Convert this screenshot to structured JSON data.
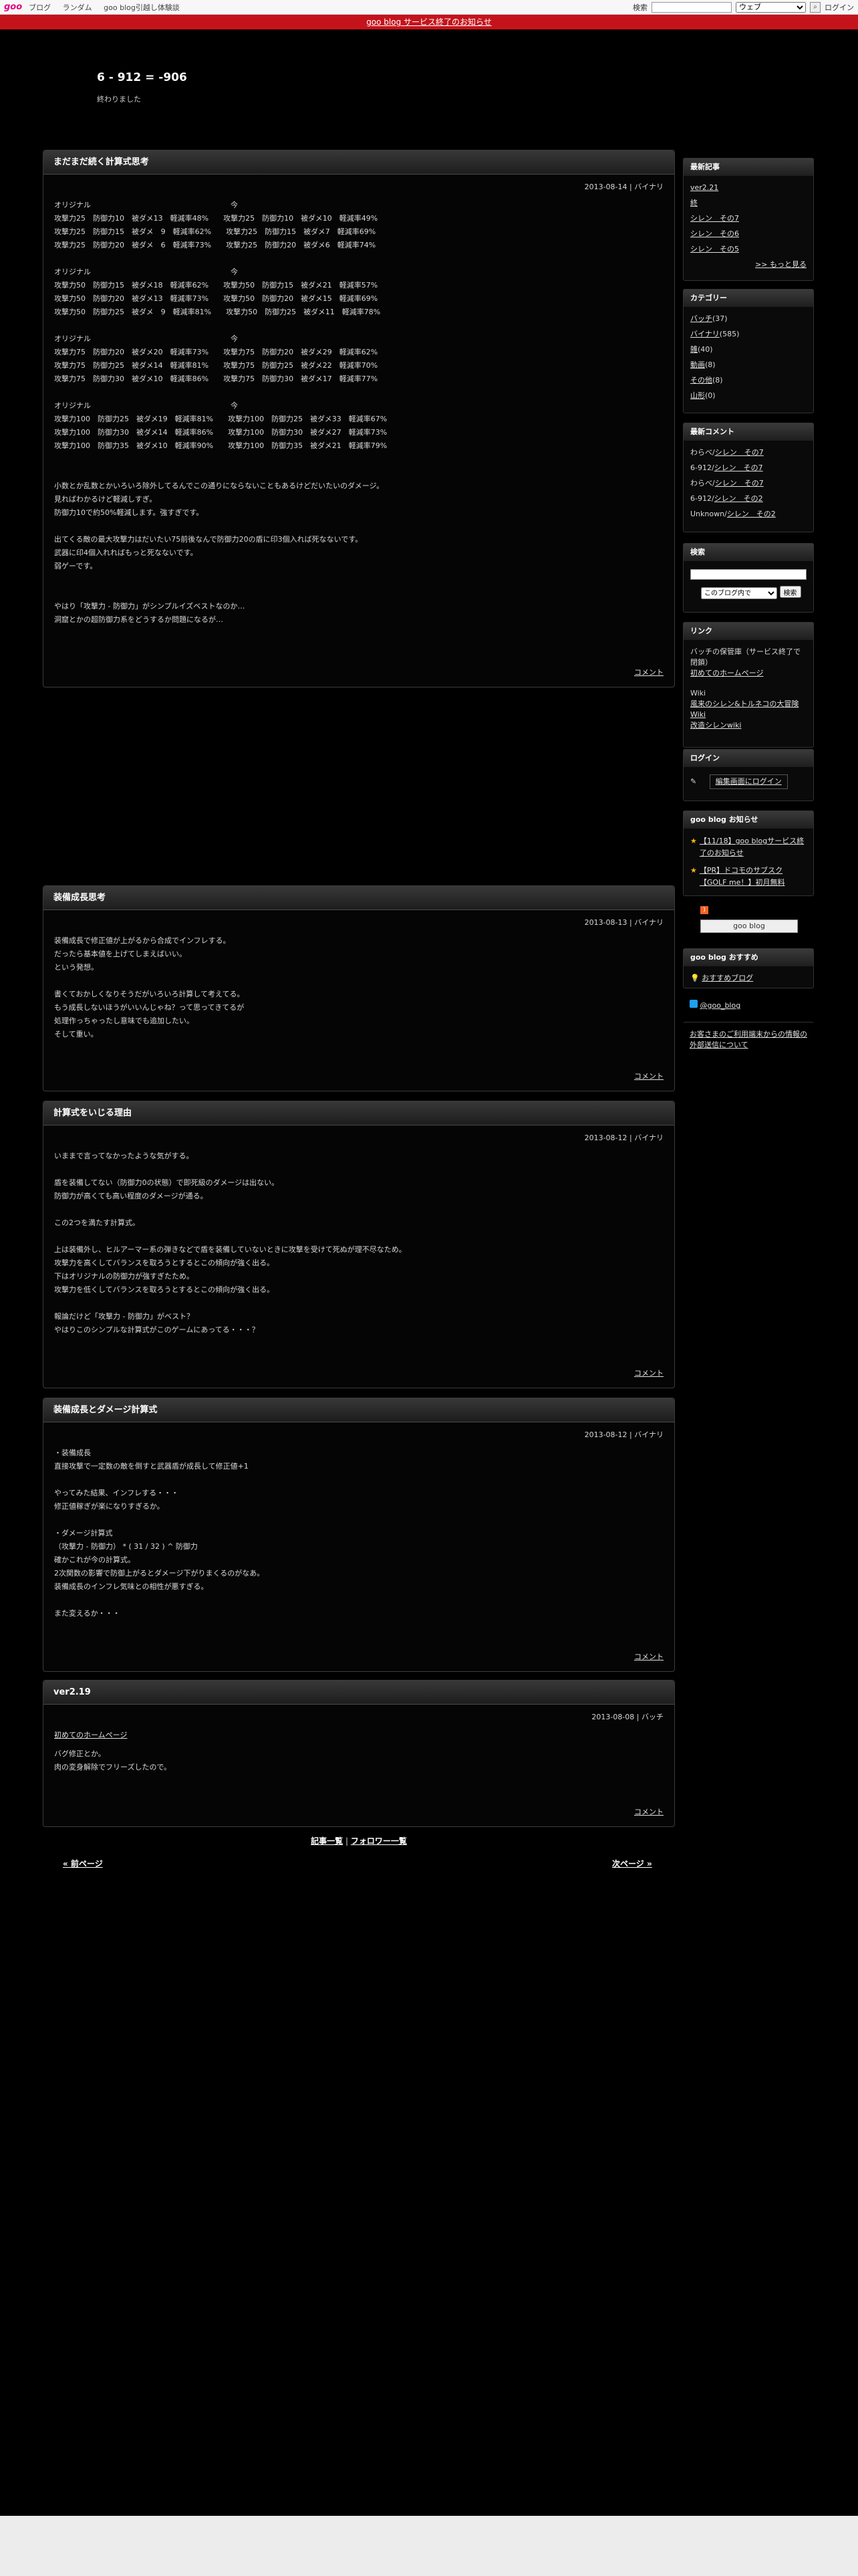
{
  "goobar": {
    "logo": "goo",
    "nav": [
      "ブログ",
      "ランダム",
      "goo blog引越し体験談"
    ],
    "search_label": "検索",
    "search_value": "",
    "search_scope": "ウェブ",
    "login": "ログイン"
  },
  "notice": "goo blog サービス終了のお知らせ",
  "blog": {
    "title": "6 - 912 = -906",
    "description": "終わりました"
  },
  "entries": [
    {
      "title": "まだまだ続く計算式思考",
      "meta": "2013-08-14 | バイナリ",
      "body": "オリジナル　　　　　　　　　　　　　　　　　　　今\n攻撃力25　防御力10　被ダメ13　軽減率48%　　攻撃力25　防御力10　被ダメ10　軽減率49%\n攻撃力25　防御力15　被ダメ　9　軽減率62%　　攻撃力25　防御力15　被ダメ7　軽減率69%\n攻撃力25　防御力20　被ダメ　6　軽減率73%　　攻撃力25　防御力20　被ダメ6　軽減率74%\n\nオリジナル　　　　　　　　　　　　　　　　　　　今\n攻撃力50　防御力15　被ダメ18　軽減率62%　　攻撃力50　防御力15　被ダメ21　軽減率57%\n攻撃力50　防御力20　被ダメ13　軽減率73%　　攻撃力50　防御力20　被ダメ15　軽減率69%\n攻撃力50　防御力25　被ダメ　9　軽減率81%　　攻撃力50　防御力25　被ダメ11　軽減率78%\n\nオリジナル　　　　　　　　　　　　　　　　　　　今\n攻撃力75　防御力20　被ダメ20　軽減率73%　　攻撃力75　防御力20　被ダメ29　軽減率62%\n攻撃力75　防御力25　被ダメ14　軽減率81%　　攻撃力75　防御力25　被ダメ22　軽減率70%\n攻撃力75　防御力30　被ダメ10　軽減率86%　　攻撃力75　防御力30　被ダメ17　軽減率77%\n\nオリジナル　　　　　　　　　　　　　　　　　　　今\n攻撃力100　防御力25　被ダメ19　軽減率81%　　攻撃力100　防御力25　被ダメ33　軽減率67%\n攻撃力100　防御力30　被ダメ14　軽減率86%　　攻撃力100　防御力30　被ダメ27　軽減率73%\n攻撃力100　防御力35　被ダメ10　軽減率90%　　攻撃力100　防御力35　被ダメ21　軽減率79%\n\n\n小数とか乱数とかいろいろ除外してるんでこの通りにならないこともあるけどだいたいのダメージ。\n見ればわかるけど軽減しすぎ。\n防御力10で約50%軽減します。強すぎです。\n\n出てくる敵の最大攻撃力はだいたい75前後なんで防御力20の盾に印3個入れば死なないです。\n武器に印4個入れればもっと死なないです。\n弱ゲーです。\n\n\nやはり「攻撃力 - 防御力」がシンプルイズベストなのか…\n洞窟とかの超防御力系をどうするか問題になるが…",
      "comment": "コメント"
    },
    {
      "title": "装備成長思考",
      "meta": "2013-08-13 | バイナリ",
      "body": "装備成長で修正値が上がるから合成でインフレする。\nだったら基本値を上げてしまえばいい。\nという発想。\n\n書くておかしくなりそうだがいろいろ計算して考えてる。\nもう成長しないほうがいいんじゃね？って思ってきてるが\n処理作っちゃったし意味でも追加したい。\nそして重い。",
      "comment": "コメント"
    },
    {
      "title": "計算式をいじる理由",
      "meta": "2013-08-12 | バイナリ",
      "body": "いままで言ってなかったような気がする。\n\n盾を装備してない（防御力0の状態）で即死級のダメージは出ない。\n防御力が高くても高い程度のダメージが通る。\n\nこの2つを満たす計算式。\n\n上は装備外し、ヒルアーマー系の弾きなどで盾を装備していないときに攻撃を受けて死ぬが理不尽なため。\n攻撃力を高くしてバランスを取ろうとするとこの傾向が強く出る。\n下はオリジナルの防御力が強すぎたため。\n攻撃力を低くしてバランスを取ろうとするとこの傾向が強く出る。\n\n報論だけど「攻撃力 - 防御力」がベスト？\nやはりこのシンプルな計算式がこのゲームにあってる・・・？",
      "comment": "コメント"
    },
    {
      "title": "装備成長とダメージ計算式",
      "meta": "2013-08-12 | バイナリ",
      "body": "・装備成長\n直接攻撃で一定数の敵を倒すと武器盾が成長して修正値+1\n\nやってみた結果、インフレする・・・\n修正値稼ぎが楽になりすぎるか。\n\n・ダメージ計算式\n（攻撃力 - 防御力） * ( 31 / 32 ) ^ 防御力\n確かこれが今の計算式。\n2次関数の影響で防御上がるとダメージ下がりまくるのがなあ。\n装備成長のインフレ気味との相性が悪すぎる。\n\nまた変えるか・・・",
      "comment": "コメント"
    },
    {
      "title": "ver2.19",
      "meta": "2013-08-08 | バッチ",
      "link": "初めてのホームページ",
      "body": "バグ修正とか。\n肉の変身解除でフリーズしたので。",
      "comment": "コメント"
    }
  ],
  "pager": {
    "entry_list": "記事一覧",
    "separator": "|",
    "follower_list": "フォロワー一覧",
    "prev": "« 前ページ",
    "next": "次ページ »"
  },
  "sidebar": {
    "recent_title": "最新記事",
    "recent": [
      "ver2.21",
      "終",
      "シレン　その7",
      "シレン　その6",
      "シレン　その5"
    ],
    "recent_more": ">> もっと見る",
    "category_title": "カテゴリー",
    "categories": [
      {
        "name": "バッチ",
        "count": "(37)"
      },
      {
        "name": "バイナリ",
        "count": "(585)"
      },
      {
        "name": "雑",
        "count": "(40)"
      },
      {
        "name": "動画",
        "count": "(8)"
      },
      {
        "name": "その他",
        "count": "(8)"
      },
      {
        "name": "山形",
        "count": "(0)"
      }
    ],
    "comments_title": "最新コメント",
    "comments": [
      {
        "user": "わらべ/",
        "post": "シレン　その7"
      },
      {
        "user": "6-912/",
        "post": "シレン　その7"
      },
      {
        "user": "わらべ/",
        "post": "シレン　その7"
      },
      {
        "user": "6-912/",
        "post": "シレン　その2"
      },
      {
        "user": "Unknown/",
        "post": "シレン　その2"
      }
    ],
    "search_title": "検索",
    "search_value": "",
    "search_scope": "このブログ内で",
    "search_button": "検索",
    "link_title": "リンク",
    "links": [
      {
        "prefix": "バッチの保管庫（サービス終了で閉鎖）",
        "text": "初めてのホームページ"
      },
      {
        "prefix": "Wiki",
        "text": "風来のシレン&トルネコの大冒険 Wiki"
      },
      {
        "prefix": "",
        "text": "改造シレンwiki"
      }
    ],
    "login_title": "ログイン",
    "login_button": "編集画面にログイン",
    "news_title": "goo blog お知らせ",
    "news": [
      "【11/18】goo blogサービス終了のお知らせ",
      "【PR】ドコモのサブスク【GOLF me！】初月無料"
    ],
    "rss_label": "goo blog",
    "recommend_title": "goo blog おすすめ",
    "recommend": "おすすめブログ",
    "twitter": "@goo_blog",
    "external_info": "お客さまのご利用端末からの情報の外部送信について"
  },
  "colors": {
    "background": "#000000",
    "notice": "#c4131b",
    "brand": "#e4007f",
    "star": "#f5b800"
  }
}
